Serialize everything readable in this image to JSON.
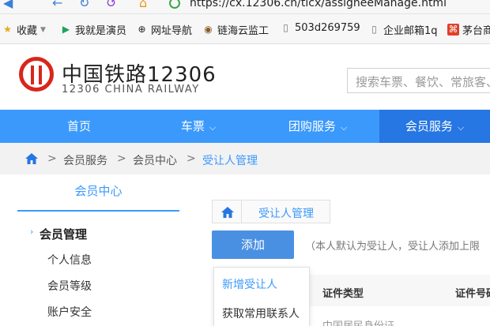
{
  "browser": {
    "url": "https://cx.12306.cn/tlcx/assigneeManage.html",
    "bookmarks": [
      {
        "label": "收藏",
        "icon": "star-icon"
      },
      {
        "label": "我就是演员",
        "icon": "video-icon"
      },
      {
        "label": "网址导航",
        "icon": "globe-icon"
      },
      {
        "label": "链海云监工",
        "icon": "bookmark-icon"
      },
      {
        "label": "503d269759",
        "icon": "page-icon"
      },
      {
        "label": "企业邮箱1q",
        "icon": "page-icon"
      },
      {
        "label": "茅台商",
        "icon": "red-icon"
      }
    ]
  },
  "header": {
    "logo_cn": "中国铁路12306",
    "logo_en": "12306 CHINA RAILWAY",
    "search_placeholder": "搜索车票、餐饮、常旅客、"
  },
  "nav": {
    "items": [
      {
        "label": "首页",
        "has_dropdown": false
      },
      {
        "label": "车票",
        "has_dropdown": true
      },
      {
        "label": "团购服务",
        "has_dropdown": true
      },
      {
        "label": "会员服务",
        "has_dropdown": true,
        "active": true
      }
    ]
  },
  "breadcrumb": {
    "items": [
      "会员服务",
      "会员中心",
      "受让人管理"
    ],
    "separator": ">"
  },
  "sidebar": {
    "title": "会员中心",
    "group": "会员管理",
    "items": [
      "个人信息",
      "会员等级",
      "账户安全"
    ]
  },
  "main": {
    "tab_label": "受让人管理",
    "add_button": "添加",
    "note": "（本人默认为受让人，受让人添加上限",
    "dropdown": [
      "新增受让人",
      "获取常用联系人"
    ],
    "columns": [
      "证件类型",
      "证件号码"
    ],
    "row_fragment": "中国居民身份证"
  },
  "colors": {
    "accent": "#3b99fc",
    "nav_active": "#2676e3",
    "logo_red": "#d8261c"
  }
}
